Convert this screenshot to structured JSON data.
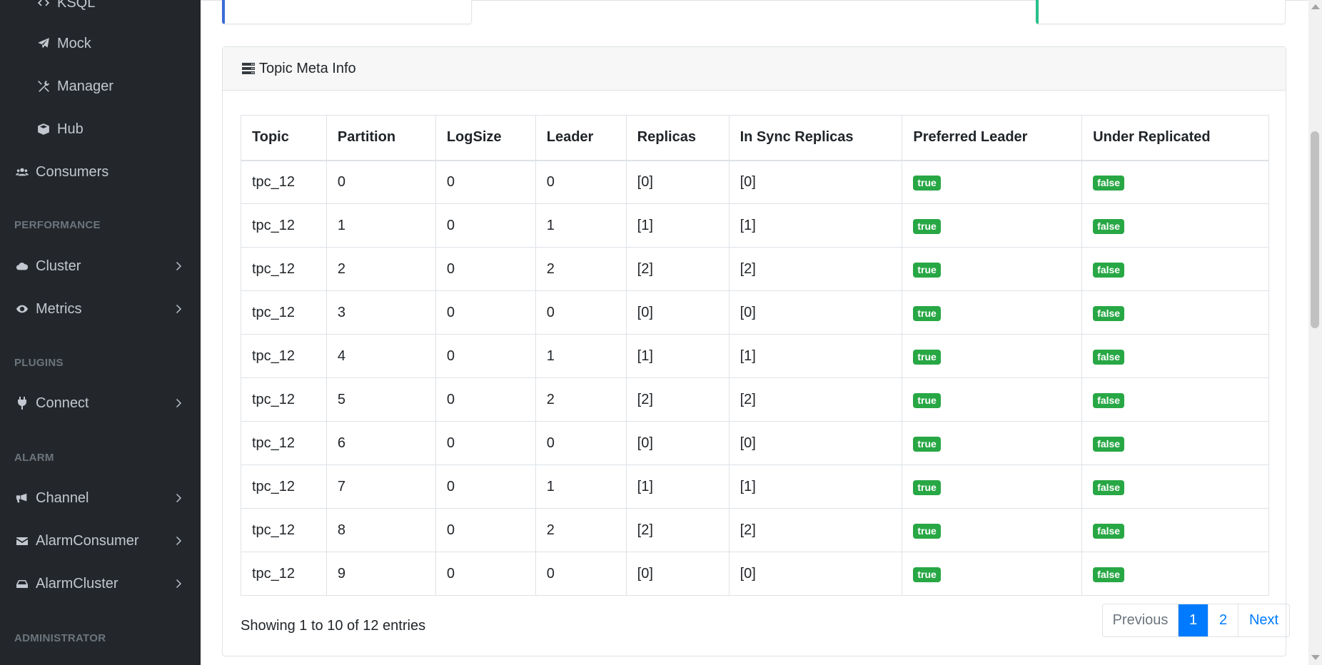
{
  "sidebar": {
    "items": [
      {
        "label": "KSQL",
        "icon": "code-icon"
      },
      {
        "label": "Mock",
        "icon": "paper-plane-icon"
      },
      {
        "label": "Manager",
        "icon": "tools-icon"
      },
      {
        "label": "Hub",
        "icon": "cube-icon"
      },
      {
        "label": "Consumers",
        "icon": "users-icon"
      },
      {
        "label": "Cluster",
        "icon": "cloud-icon"
      },
      {
        "label": "Metrics",
        "icon": "eye-icon"
      },
      {
        "label": "Connect",
        "icon": "plug-icon"
      },
      {
        "label": "Channel",
        "icon": "bullhorn-icon"
      },
      {
        "label": "AlarmConsumer",
        "icon": "envelope-icon"
      },
      {
        "label": "AlarmCluster",
        "icon": "hdd-icon"
      }
    ],
    "sections": {
      "performance": "PERFORMANCE",
      "plugins": "PLUGINS",
      "alarm": "ALARM",
      "administrator": "ADMINISTRATOR"
    }
  },
  "card": {
    "title": "Topic Meta Info",
    "icon": "server-icon"
  },
  "table": {
    "headers": [
      "Topic",
      "Partition",
      "LogSize",
      "Leader",
      "Replicas",
      "In Sync Replicas",
      "Preferred Leader",
      "Under Replicated"
    ],
    "rows": [
      [
        "tpc_12",
        "0",
        "0",
        "0",
        "[0]",
        "[0]",
        "true",
        "false"
      ],
      [
        "tpc_12",
        "1",
        "0",
        "1",
        "[1]",
        "[1]",
        "true",
        "false"
      ],
      [
        "tpc_12",
        "2",
        "0",
        "2",
        "[2]",
        "[2]",
        "true",
        "false"
      ],
      [
        "tpc_12",
        "3",
        "0",
        "0",
        "[0]",
        "[0]",
        "true",
        "false"
      ],
      [
        "tpc_12",
        "4",
        "0",
        "1",
        "[1]",
        "[1]",
        "true",
        "false"
      ],
      [
        "tpc_12",
        "5",
        "0",
        "2",
        "[2]",
        "[2]",
        "true",
        "false"
      ],
      [
        "tpc_12",
        "6",
        "0",
        "0",
        "[0]",
        "[0]",
        "true",
        "false"
      ],
      [
        "tpc_12",
        "7",
        "0",
        "1",
        "[1]",
        "[1]",
        "true",
        "false"
      ],
      [
        "tpc_12",
        "8",
        "0",
        "2",
        "[2]",
        "[2]",
        "true",
        "false"
      ],
      [
        "tpc_12",
        "9",
        "0",
        "0",
        "[0]",
        "[0]",
        "true",
        "false"
      ]
    ]
  },
  "pagination": {
    "info": "Showing 1 to 10 of 12 entries",
    "previous": "Previous",
    "page1": "1",
    "page2": "2",
    "next": "Next"
  },
  "colors": {
    "sidebar_bg": "#23272b",
    "badge_green": "#28a745",
    "accent_blue": "#007bff"
  }
}
